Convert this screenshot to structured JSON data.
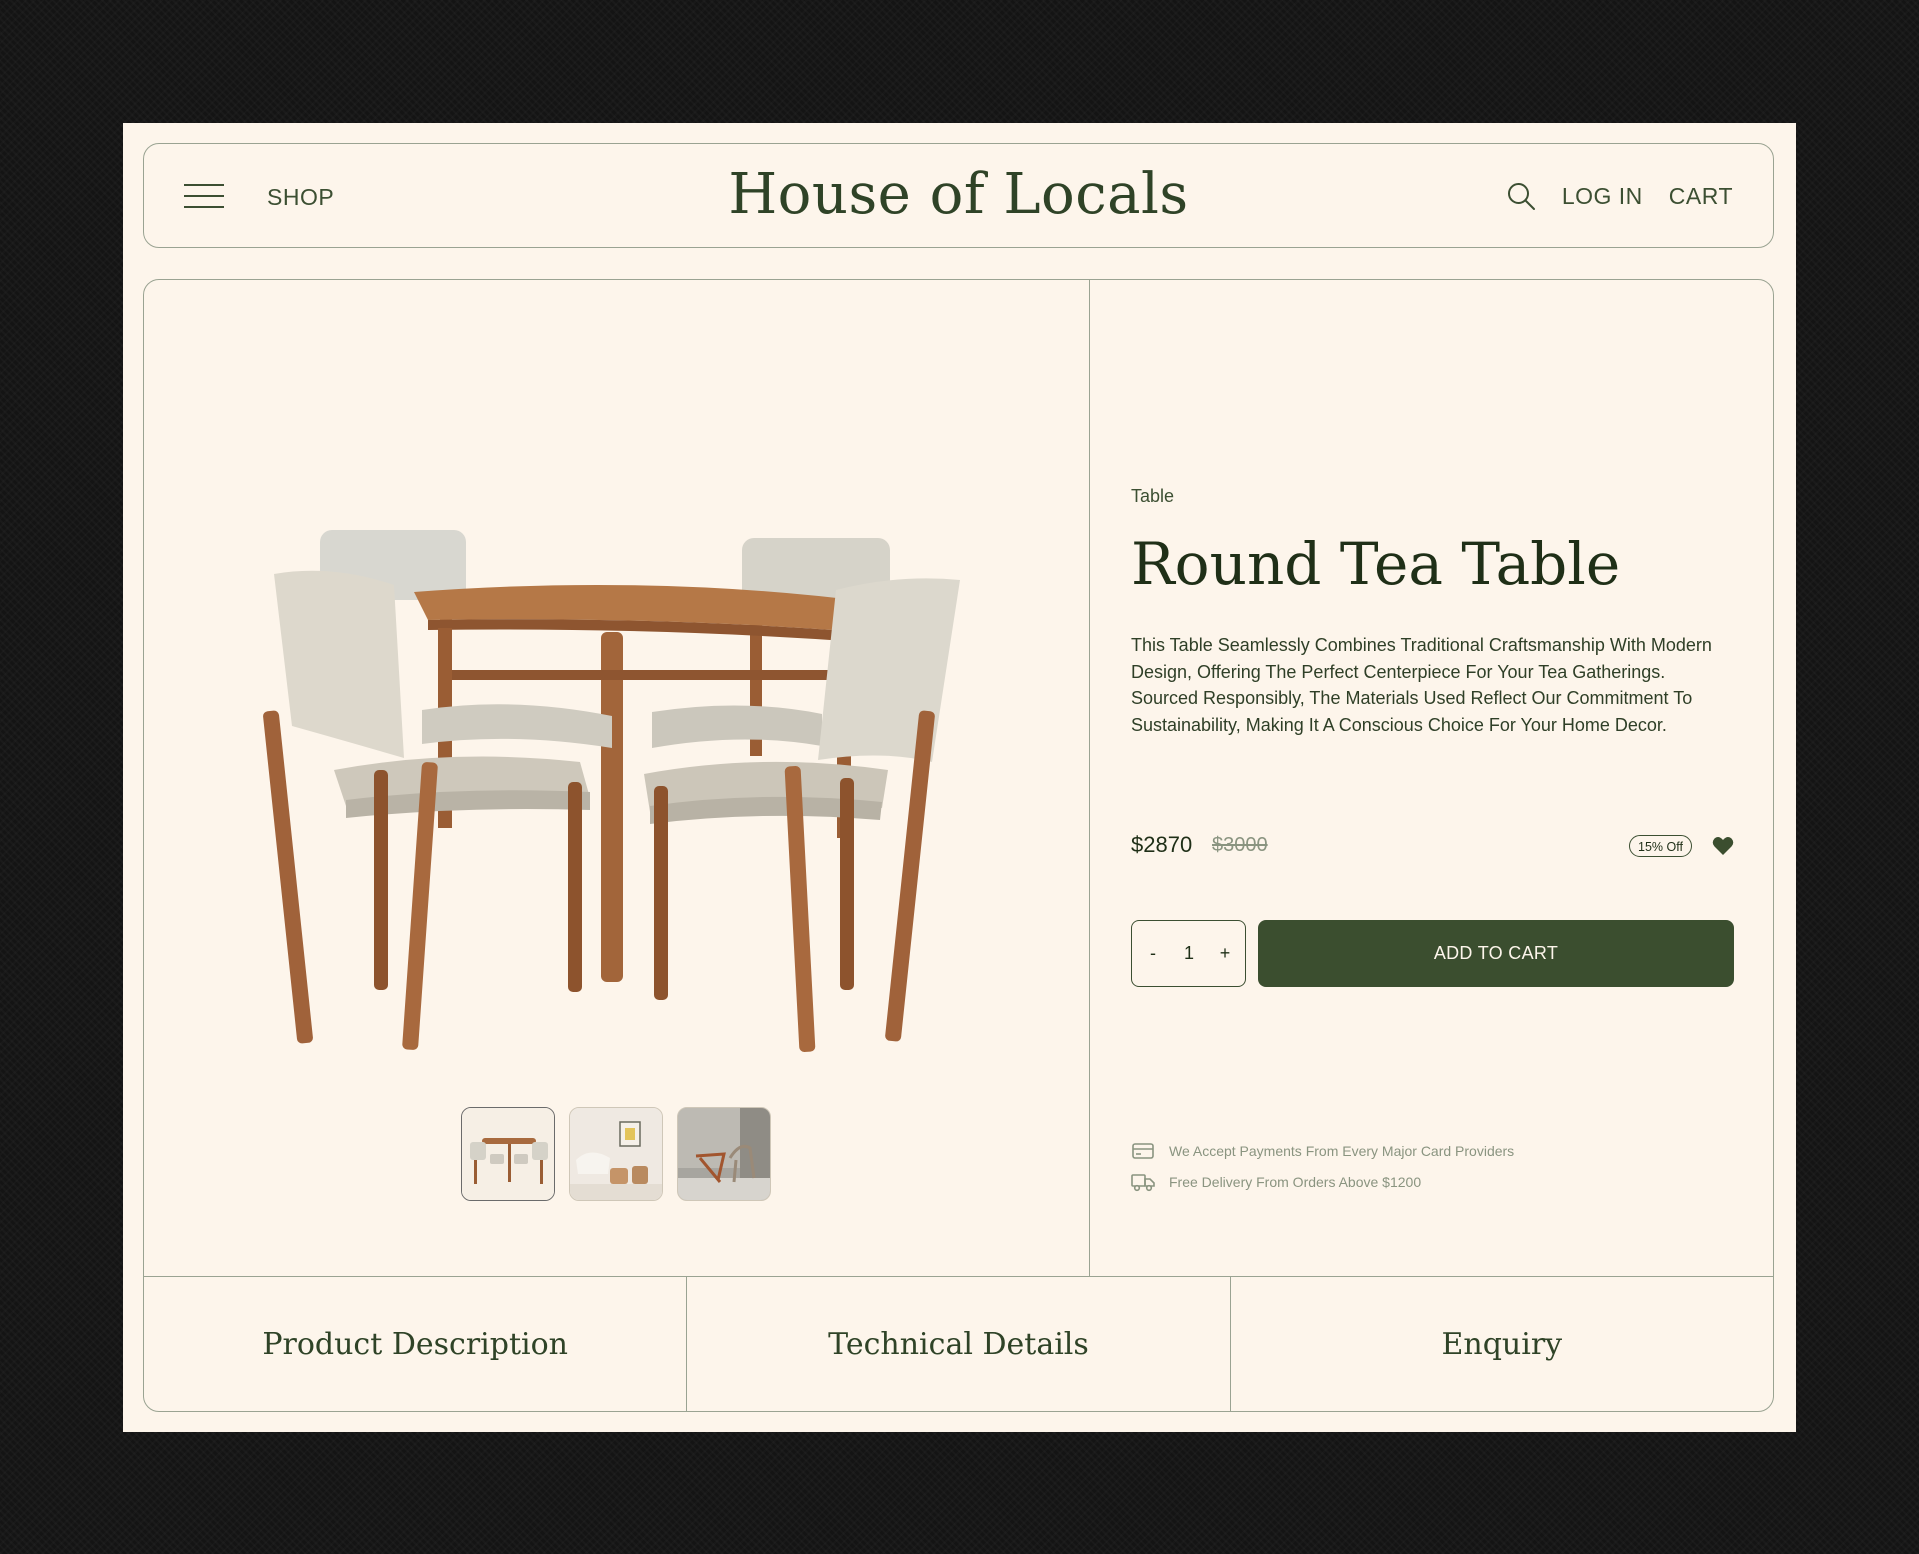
{
  "header": {
    "shop_label": "SHOP",
    "brand": "House of Locals",
    "login_label": "LOG IN",
    "cart_label": "CART",
    "icons": [
      "hamburger-menu-icon",
      "search-icon"
    ]
  },
  "product": {
    "category": "Table",
    "title": "Round Tea Table",
    "description": "This Table Seamlessly Combines Traditional Craftsmanship With Modern Design, Offering The Perfect Centerpiece For Your Tea Gatherings. Sourced Responsibly, The Materials Used Reflect Our Commitment To Sustainability, Making It A Conscious Choice For Your Home Decor.",
    "price": "$2870",
    "original_price": "$3000",
    "discount": "15% Off",
    "quantity": "1",
    "decrement_label": "-",
    "increment_label": "+",
    "add_to_cart_label": "ADD TO CART",
    "perks": [
      {
        "icon": "credit-card-icon",
        "text": "We Accept Payments From Every Major Card Providers"
      },
      {
        "icon": "delivery-truck-icon",
        "text": "Free Delivery From Orders Above $1200"
      }
    ],
    "thumbnails": [
      {
        "icon": "dining-set-thumbnail",
        "active": true
      },
      {
        "icon": "living-room-thumbnail",
        "active": false
      },
      {
        "icon": "lounge-chair-thumbnail",
        "active": false
      }
    ]
  },
  "tabs": [
    {
      "label": "Product Description"
    },
    {
      "label": "Technical Details"
    },
    {
      "label": "Enquiry"
    }
  ],
  "colors": {
    "background": "#141414",
    "page": "#fdf5eb",
    "accent": "#3b4e2f",
    "border": "#9aa392",
    "muted_text": "#8a9480"
  }
}
